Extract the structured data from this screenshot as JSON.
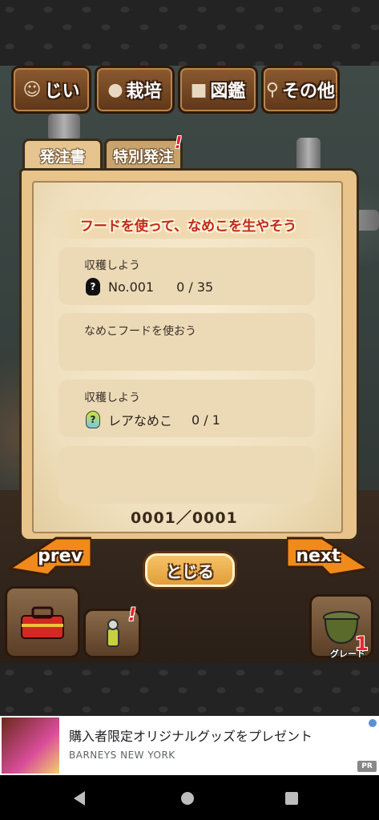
{
  "menu": {
    "items": [
      {
        "label": "じい",
        "icon": "elder-icon"
      },
      {
        "label": "栽培",
        "icon": "log-icon"
      },
      {
        "label": "図鑑",
        "icon": "book-icon"
      },
      {
        "label": "その他",
        "icon": "magnifier-icon"
      }
    ]
  },
  "tabs": {
    "order_label": "発注書",
    "special_label": "特別発注",
    "special_alert": "!"
  },
  "panel": {
    "title": "フードを使って、なめこを生やそう",
    "tasks": [
      {
        "title": "収穫しよう",
        "number": "No.001",
        "progress": "0 / 35",
        "icon": "dark-nameko-icon"
      },
      {
        "title": "なめこフードを使おう"
      },
      {
        "title": "収穫しよう",
        "name": "レアなめこ",
        "progress": "0 / 1",
        "icon": "rare-nameko-icon"
      },
      {
        "title": ""
      }
    ],
    "counter": "0001／0001"
  },
  "nav": {
    "prev_label": "prev",
    "next_label": "next",
    "close_label": "とじる"
  },
  "bottom": {
    "toolbox_icon": "toolbox-icon",
    "spray_icon": "spray-icon",
    "spray_alert": "!",
    "grade_label": "グレード",
    "grade_value": "1"
  },
  "ad": {
    "title": "購入者限定オリジナルグッズをプレゼント",
    "advertiser": "BARNEYS NEW YORK",
    "badge": "PR"
  },
  "colors": {
    "title_red": "#c02a18",
    "parchment": "#f7ecd3",
    "frame": "#e8c48a"
  }
}
